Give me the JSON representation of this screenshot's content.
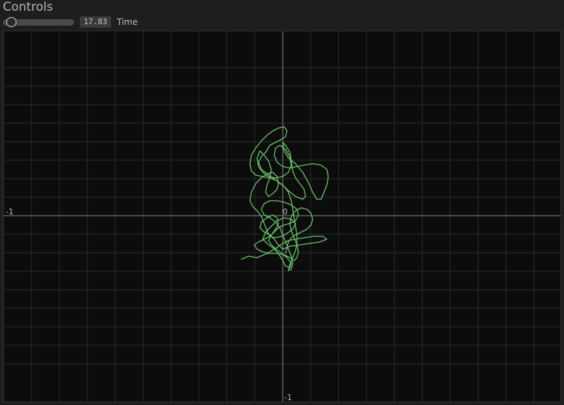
{
  "panel": {
    "title": "Controls"
  },
  "time_control": {
    "value_text": "17.83",
    "label": "Time",
    "slider_fraction": 0.12
  },
  "plot": {
    "x_axis_left_label": "-1",
    "origin_label": "0",
    "y_axis_bottom_label": "-1",
    "curve_color": "#6ac46a"
  }
}
